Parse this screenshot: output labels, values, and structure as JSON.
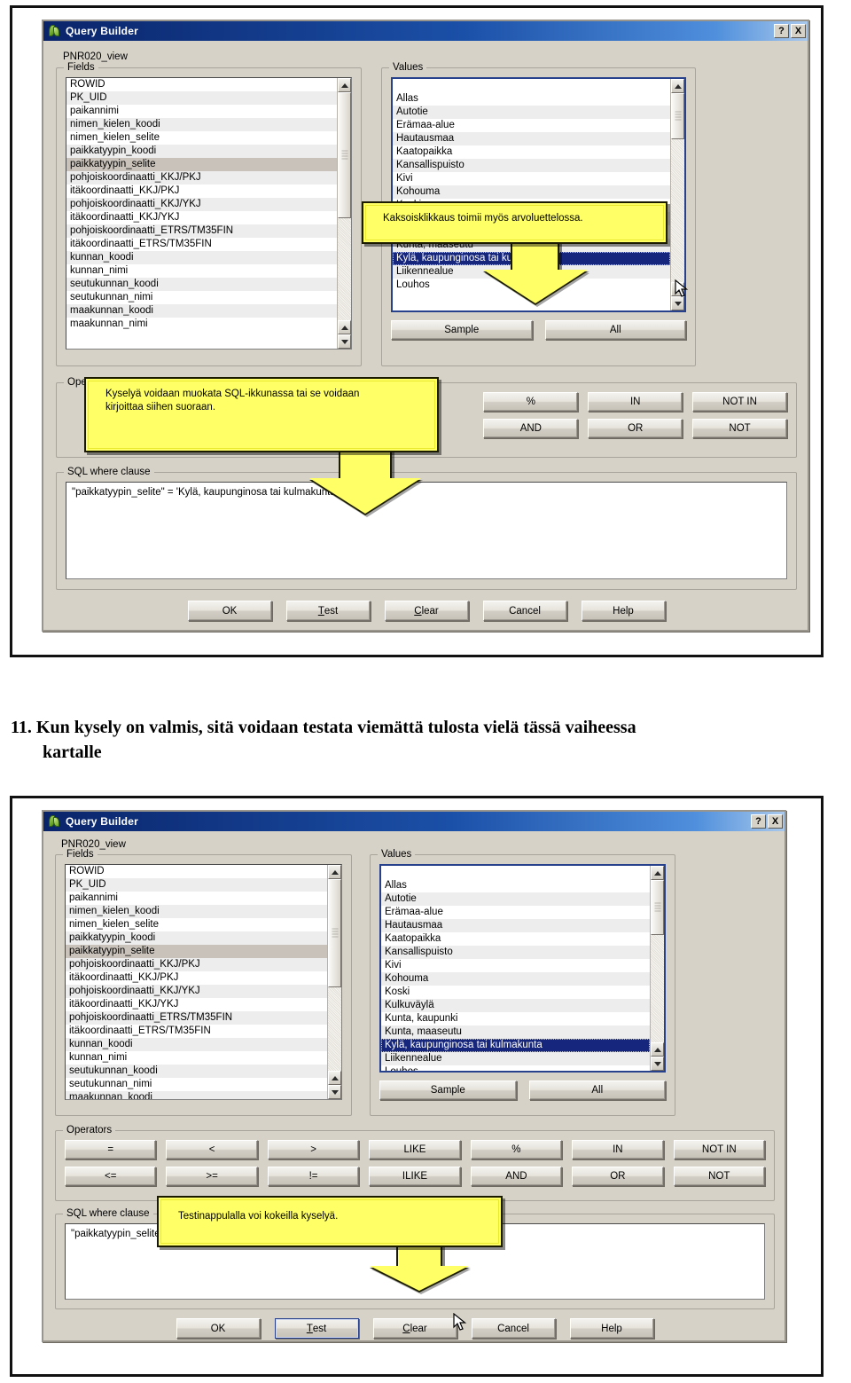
{
  "caption": {
    "number": "11.",
    "line1": "Kun kysely on valmis, sitä voidaan testata viemättä tulosta vielä tässä vaiheessa",
    "line2": "kartalle"
  },
  "dialog": {
    "title": "Query Builder",
    "help_button": "?",
    "close_button": "X",
    "view_name": "PNR020_view",
    "fields_legend": "Fields",
    "values_legend": "Values",
    "operators_legend": "Operators",
    "sql_legend": "SQL where clause",
    "sample_label": "Sample",
    "all_label": "All",
    "sql_text": "\"paikkatyypin_selite\" = 'Kylä, kaupunginosa tai kulmakunta'"
  },
  "fields": [
    "ROWID",
    "PK_UID",
    "paikannimi",
    "nimen_kielen_koodi",
    "nimen_kielen_selite",
    "paikkatyypin_koodi",
    "paikkatyypin_selite",
    "pohjoiskoordinaatti_KKJ/PKJ",
    "itäkoordinaatti_KKJ/PKJ",
    "pohjoiskoordinaatti_KKJ/YKJ",
    "itäkoordinaatti_KKJ/YKJ",
    "pohjoiskoordinaatti_ETRS/TM35FIN",
    "itäkoordinaatti_ETRS/TM35FIN",
    "kunnan_koodi",
    "kunnan_nimi",
    "seutukunnan_koodi",
    "seutukunnan_nimi",
    "maakunnan_koodi",
    "maakunnan_nimi"
  ],
  "fields_selected": "paikkatyypin_selite",
  "values": [
    "Allas",
    "Autotie",
    "Erämaa-alue",
    "Hautausmaa",
    "Kaatopaikka",
    "Kansallispuisto",
    "Kivi",
    "Kohouma",
    "Koski",
    "Kulkuväylä",
    "Kunta, kaupunki",
    "Kunta, maaseutu",
    "Kylä, kaupunginosa tai kulmakunta",
    "Liikennealue",
    "Louhos"
  ],
  "values_selected": "Kylä, kaupunginosa tai kulmakunta",
  "operators_row1": [
    "=",
    "<",
    ">",
    "LIKE",
    "%",
    "IN",
    "NOT IN"
  ],
  "operators_row2": [
    "<=",
    ">=",
    "!=",
    "ILIKE",
    "AND",
    "OR",
    "NOT"
  ],
  "dialog_buttons": [
    {
      "label": "OK",
      "accel": ""
    },
    {
      "label": "Test",
      "accel": "T"
    },
    {
      "label": "Clear",
      "accel": "C"
    },
    {
      "label": "Cancel",
      "accel": ""
    },
    {
      "label": "Help",
      "accel": ""
    }
  ],
  "callouts": {
    "values_hint": "Kaksoisklikkaus toimii myös arvoluettelossa.",
    "operators_hint_line1": "Kyselyä voidaan muokata SQL-ikkunassa tai se voidaan",
    "operators_hint_line2": "kirjoittaa siihen suoraan.",
    "test_hint": "Testinappulalla voi kokeilla kyselyä."
  },
  "colors": {
    "titlebar_start": "#0a246a",
    "titlebar_end": "#a8c8ec",
    "dialog_face": "#d6d2c8",
    "selection": "#16267c",
    "callout_yellow": "#ffff66",
    "focus_border": "#27418c"
  }
}
